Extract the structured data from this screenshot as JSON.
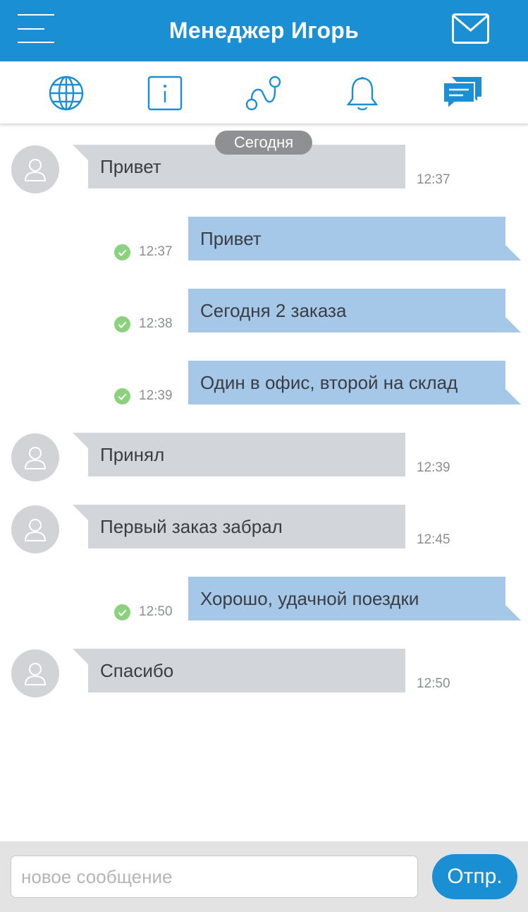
{
  "header": {
    "title": "Менеджер Игорь",
    "menu_icon": "hamburger-menu-icon",
    "mail_icon": "envelope-icon"
  },
  "tabs": [
    {
      "icon": "globe-icon",
      "active": false
    },
    {
      "icon": "info-icon",
      "active": false
    },
    {
      "icon": "route-icon",
      "active": false
    },
    {
      "icon": "bell-icon",
      "active": false
    },
    {
      "icon": "chat-bubbles-icon",
      "active": true
    }
  ],
  "chat": {
    "date_separator": "Сегодня",
    "messages": [
      {
        "direction": "in",
        "text": "Привет",
        "time": "12:37"
      },
      {
        "direction": "out",
        "text": "Привет",
        "time": "12:37",
        "read": true
      },
      {
        "direction": "out",
        "text": "Сегодня 2 заказа",
        "time": "12:38",
        "read": true
      },
      {
        "direction": "out",
        "text": "Один в офис, второй на склад",
        "time": "12:39",
        "read": true
      },
      {
        "direction": "in",
        "text": "Принял",
        "time": "12:39"
      },
      {
        "direction": "in",
        "text": "Первый заказ забрал",
        "time": "12:45"
      },
      {
        "direction": "out",
        "text": "Хорошо, удачной поездки",
        "time": "12:50",
        "read": true
      },
      {
        "direction": "in",
        "text": "Спасибо",
        "time": "12:50"
      }
    ]
  },
  "composer": {
    "placeholder": "новое сообщение",
    "value": "",
    "send_label": "Отпр."
  },
  "colors": {
    "accent": "#1a8fd3",
    "incoming_bubble": "#d2d5da",
    "outgoing_bubble": "#a6c8e8",
    "read_check": "#8cd17d"
  }
}
